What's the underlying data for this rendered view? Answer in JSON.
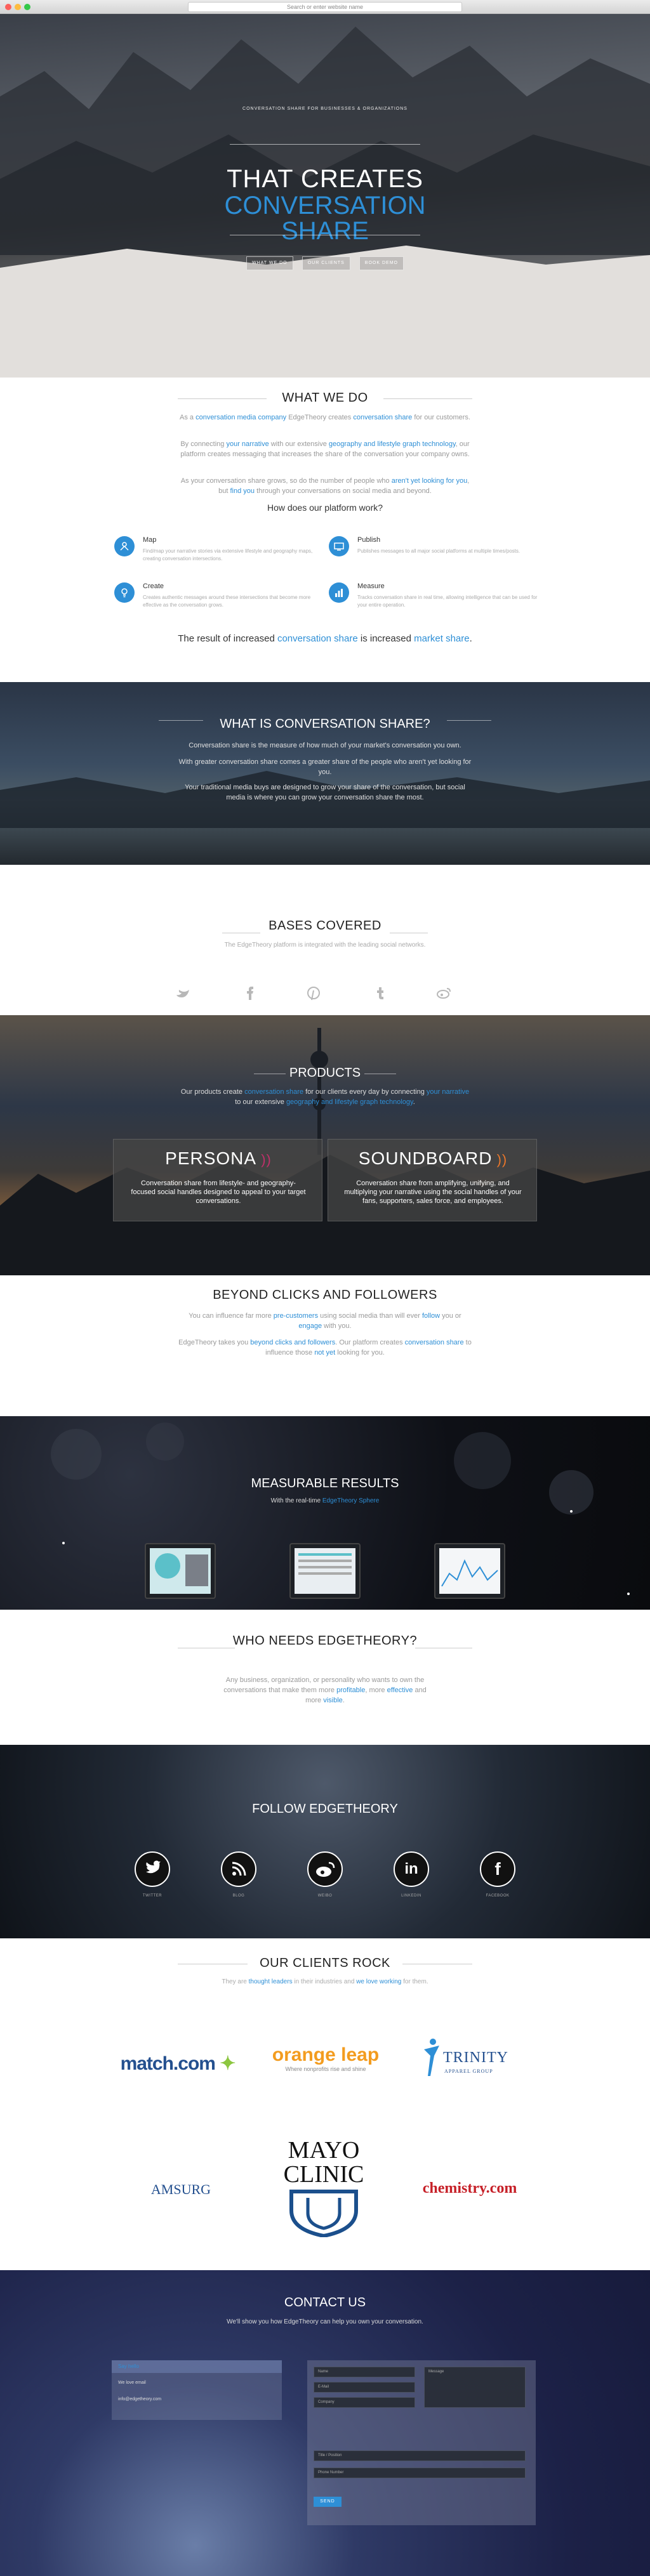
{
  "browser": {
    "url_placeholder": "Search or enter website name"
  },
  "hero": {
    "kicker": "CONVERSATION SHARE FOR BUSINESSES & ORGANIZATIONS",
    "title_line1": "THAT CREATES",
    "title_line2": "CONVERSATION",
    "title_line3": "SHARE",
    "buttons": [
      "WHAT WE DO",
      "OUR CLIENTS",
      "BOOK DEMO"
    ]
  },
  "what_we_do": {
    "title": "WHAT WE DO",
    "p1_a": "As a ",
    "p1_b": "conversation media company",
    "p1_c": " EdgeTheory creates ",
    "p1_d": "conversation share",
    "p1_e": " for our customers.",
    "p2_a": "By connecting ",
    "p2_b": "your narrative",
    "p2_c": " with our extensive ",
    "p2_d": "geography and lifestyle graph technology",
    "p2_e": ", our platform creates messaging that increases the share of the conversation your company owns.",
    "p3_a": "As your conversation share grows, so do the number of people who ",
    "p3_b": "aren't yet looking for you",
    "p3_c": ", but ",
    "p3_d": "find you",
    "p3_e": " through your conversations on social media and beyond.",
    "subheading": "How does our platform work?",
    "items": [
      {
        "title": "Map",
        "desc": "Find/map your narrative stories via extensive lifestyle and geography maps, creating conversation intersections."
      },
      {
        "title": "Publish",
        "desc": "Publishes messages to all major social platforms at multiple times/posts."
      },
      {
        "title": "Create",
        "desc": "Creates authentic messages around these intersections that become more effective as the conversation grows."
      },
      {
        "title": "Measure",
        "desc": "Tracks conversation share in real time, allowing intelligence that can be used for your entire operation."
      }
    ],
    "result_a": "The result of increased ",
    "result_b": "conversation share",
    "result_c": " is increased ",
    "result_d": "market share",
    "result_e": "."
  },
  "conversation_share": {
    "title": "WHAT IS CONVERSATION SHARE?",
    "p1": "Conversation share is the measure of how much of your market's conversation you own.",
    "p2": "With greater conversation share comes a greater share of the people who aren't yet looking for you.",
    "p3": "Your traditional media buys are designed to grow your share of the conversation, but social media is where you can grow your conversation share the most."
  },
  "bases": {
    "title": "BASES COVERED",
    "subtitle": "The EdgeTheory platform is integrated with the leading social networks.",
    "icons": [
      "twitter-icon",
      "facebook-icon",
      "pinterest-icon",
      "tumblr-icon",
      "weibo-icon"
    ]
  },
  "products": {
    "title": "PRODUCTS",
    "desc_a": "Our products create ",
    "desc_b": "conversation share",
    "desc_c": " for our clients every day by connecting ",
    "desc_d": "your narrative",
    "desc_e": " to our extensive ",
    "desc_f": "geography and lifestyle graph technology",
    "desc_g": ".",
    "persona": {
      "name": "PERSONA",
      "desc": "Conversation share from lifestyle- and geography-focused social handles designed to appeal to your target conversations."
    },
    "soundboard": {
      "name": "SOUNDBOARD",
      "desc": "Conversation share from amplifying, unifying, and multiplying your narrative using the social handles of your fans, supporters, sales force, and employees."
    }
  },
  "beyond": {
    "title": "BEYOND CLICKS AND FOLLOWERS",
    "p1_a": "You can influence far more ",
    "p1_b": "pre-customers",
    "p1_c": " using social media than will ever ",
    "p1_d": "follow",
    "p1_e": " you or ",
    "p1_f": "engage",
    "p1_g": " with you.",
    "p2_a": "EdgeTheory takes you ",
    "p2_b": "beyond clicks and followers",
    "p2_c": ". Our platform creates ",
    "p2_d": "conversation share",
    "p2_e": " to influence those ",
    "p2_f": "not yet",
    "p2_g": " looking for you."
  },
  "measurable": {
    "title": "MEASURABLE RESULTS",
    "sub_a": "With the real-time ",
    "sub_b": "EdgeTheory Sphere"
  },
  "who": {
    "title": "WHO NEEDS EDGETHEORY?",
    "p_a": "Any business, organization, or personality who wants to own the conversations that make them more ",
    "p_b": "profitable",
    "p_c": ", more ",
    "p_d": "effective",
    "p_e": " and more ",
    "p_f": "visible",
    "p_g": "."
  },
  "follow": {
    "title": "FOLLOW EDGETHEORY",
    "networks": [
      {
        "icon": "twitter-icon",
        "label": "TWITTER"
      },
      {
        "icon": "rss-icon",
        "label": "BLOG"
      },
      {
        "icon": "weibo-icon",
        "label": "WEIBO"
      },
      {
        "icon": "linkedin-icon",
        "label": "LINKEDIN"
      },
      {
        "icon": "facebook-icon",
        "label": "FACEBOOK"
      }
    ]
  },
  "clients": {
    "title": "OUR CLIENTS ROCK",
    "sub_a": "They are ",
    "sub_b": "thought leaders",
    "sub_c": " in their industries and ",
    "sub_d": "we love working",
    "sub_e": " for them.",
    "logos": {
      "match": "match.com",
      "orange": "orange leap",
      "orange_tag": "Where nonprofits rise and shine",
      "trinity": "TRINITY",
      "trinity_sub": "APPAREL GROUP",
      "amsurg": "AMSURG",
      "mayo1": "MAYO",
      "mayo2": "CLINIC",
      "chemistry": "chemistry.com"
    }
  },
  "contact": {
    "title": "CONTACT US",
    "subtitle": "We'll show you how EdgeTheory can help you own your conversation.",
    "info": [
      "Say hello",
      "We love email",
      "info@edgetheory.com"
    ],
    "fields": {
      "name": "Name",
      "email": "E-Mail",
      "company": "Company",
      "message": "Message",
      "title_field": "Title / Position",
      "phone": "Phone Number"
    },
    "send": "SEND"
  },
  "colors": {
    "accent": "#2e8fd6"
  }
}
